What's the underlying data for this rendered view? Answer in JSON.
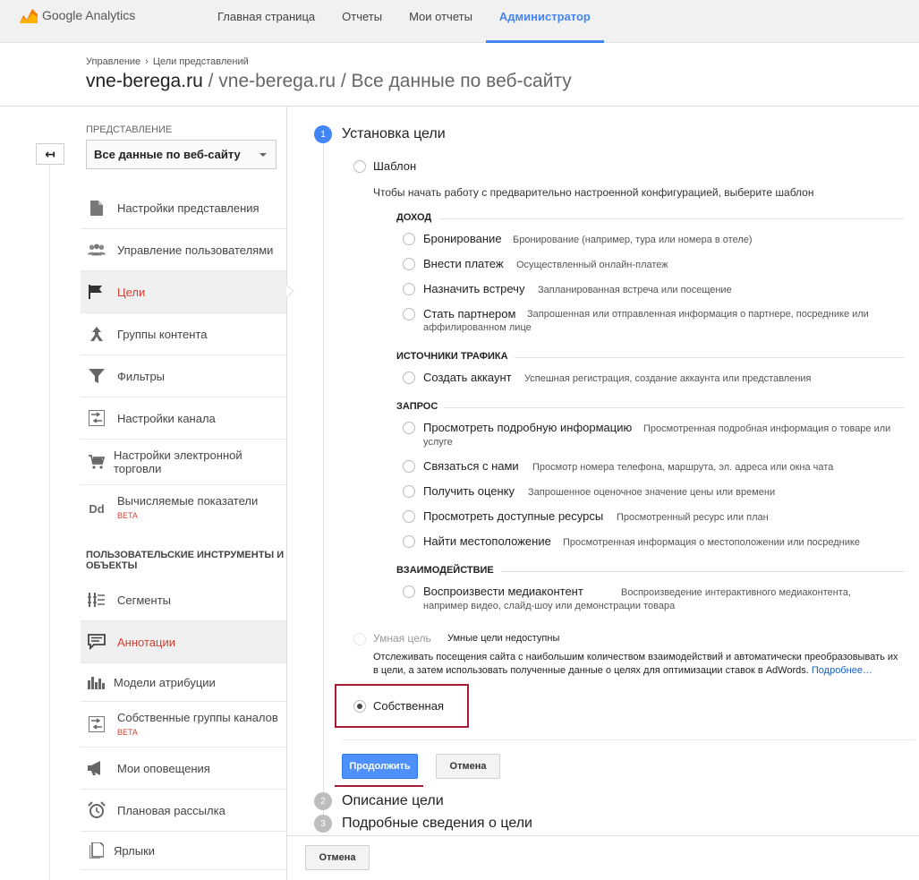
{
  "app": {
    "logo_text": "Google Analytics"
  },
  "nav": {
    "items": [
      "Главная страница",
      "Отчеты",
      "Мои отчеты",
      "Администратор"
    ],
    "active_index": 3
  },
  "header": {
    "breadcrumb": [
      "Управление",
      "Цели представлений"
    ],
    "breadcrumb_sep": "›",
    "title": "vne-berega.ru",
    "subtitle": "/ vne-berega.ru / Все данные по веб-сайту"
  },
  "sidebar": {
    "back_label": "↤",
    "view_label": "ПРЕДСТАВЛЕНИЕ",
    "view_value": "Все данные по веб-сайту",
    "items": [
      {
        "label": "Настройки представления",
        "icon": "document-icon"
      },
      {
        "label": "Управление пользователями",
        "icon": "users-icon"
      },
      {
        "label": "Цели",
        "icon": "flag-icon",
        "selected": true
      },
      {
        "label": "Группы контента",
        "icon": "content-groups-icon"
      },
      {
        "label": "Фильтры",
        "icon": "filter-icon"
      },
      {
        "label": "Настройки канала",
        "icon": "channel-settings-icon"
      },
      {
        "label": "Настройки электронной торговли",
        "icon": "cart-icon"
      },
      {
        "label": "Вычисляемые показатели",
        "icon": "dd-icon",
        "badge": "BETA"
      }
    ],
    "section_title": "ПОЛЬЗОВАТЕЛЬСКИЕ ИНСТРУМЕНТЫ И ОБЪЕКТЫ",
    "tools": [
      {
        "label": "Сегменты",
        "icon": "segments-icon"
      },
      {
        "label": "Аннотации",
        "icon": "annotations-icon",
        "selected": true
      },
      {
        "label": "Модели атрибуции",
        "icon": "attribution-icon"
      },
      {
        "label": "Собственные группы каналов",
        "icon": "channel-groups-icon",
        "badge": "BETA"
      },
      {
        "label": "Мои оповещения",
        "icon": "megaphone-icon"
      },
      {
        "label": "Плановая рассылка",
        "icon": "alarm-clock-icon"
      },
      {
        "label": "Ярлыки",
        "icon": "shortcuts-icon"
      }
    ]
  },
  "goal_setup": {
    "steps": [
      {
        "number": "1",
        "title": "Установка цели",
        "active": true
      },
      {
        "number": "2",
        "title": "Описание цели"
      },
      {
        "number": "3",
        "title": "Подробные сведения о цели"
      }
    ],
    "template_label": "Шаблон",
    "template_hint": "Чтобы начать работу с предварительно настроенной конфигурацией, выберите шаблон",
    "groups": [
      {
        "name": "ДОХОД",
        "options": [
          {
            "label": "Бронирование",
            "desc": "Бронирование (например, тура или номера в отеле)"
          },
          {
            "label": "Внести платеж",
            "desc": "Осуществленный онлайн-платеж"
          },
          {
            "label": "Назначить встречу",
            "desc": "Запланированная встреча или посещение"
          },
          {
            "label": "Стать партнером",
            "desc": "Запрошенная или отправленная информация о партнере, посреднике или аффилированном лице"
          }
        ]
      },
      {
        "name": "ИСТОЧНИКИ ТРАФИКА",
        "options": [
          {
            "label": "Создать аккаунт",
            "desc": "Успешная регистрация, создание аккаунта или представления"
          }
        ]
      },
      {
        "name": "ЗАПРОС",
        "options": [
          {
            "label": "Просмотреть подробную информацию",
            "desc": "Просмотренная подробная информация о товаре или услуге"
          },
          {
            "label": "Связаться с нами",
            "desc": "Просмотр номера телефона, маршрута, эл. адреса или окна чата"
          },
          {
            "label": "Получить оценку",
            "desc": "Запрошенное оценочное значение цены или времени"
          },
          {
            "label": "Просмотреть доступные ресурсы",
            "desc": "Просмотренный ресурс или план"
          },
          {
            "label": "Найти местоположение",
            "desc": "Просмотренная информация о местоположении или посреднике"
          }
        ]
      },
      {
        "name": "ВЗАИМОДЕЙСТВИЕ",
        "options": [
          {
            "label": "Воспроизвести медиаконтент",
            "desc": "Воспроизведение интерактивного медиаконтента, например видео, слайд-шоу или демонстрации товара"
          }
        ]
      }
    ],
    "smart_label": "Умная цель",
    "smart_note": "Умные цели недоступны",
    "smart_desc": "Отслеживать посещения сайта с наибольшим количеством взаимодействий и автоматически преобразовывать их в цели, а затем использовать полученные данные о целях для оптимизации ставок в AdWords.",
    "smart_more": "Подробнее…",
    "custom_label": "Собственная",
    "selected_option": "Собственная",
    "continue_button": "Продолжить",
    "cancel_button": "Отмена"
  },
  "footer": {
    "cancel_button": "Отмена"
  },
  "colors": {
    "accent": "#4285f4",
    "highlight": "#a51c30",
    "selected_label": "#d23f31"
  }
}
